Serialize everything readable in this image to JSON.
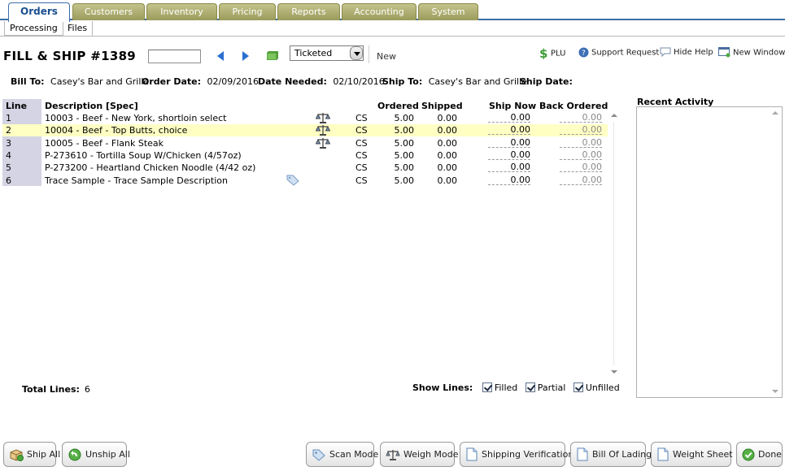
{
  "tabs": [
    {
      "label": "Orders",
      "active": true
    },
    {
      "label": "Customers"
    },
    {
      "label": "Inventory"
    },
    {
      "label": "Pricing"
    },
    {
      "label": "Reports"
    },
    {
      "label": "Accounting"
    },
    {
      "label": "System"
    }
  ],
  "subtabs": [
    {
      "label": "Processing",
      "active": true
    },
    {
      "label": "Files"
    }
  ],
  "header": {
    "title": "FILL & SHIP #1389",
    "order_input_value": "",
    "status_value": "Ticketed",
    "new_label": "New",
    "links": {
      "plu": "PLU",
      "support": "Support Request",
      "hide_help": "Hide Help",
      "new_window": "New Window"
    }
  },
  "info": {
    "bill_to_label": "Bill To:",
    "bill_to": "Casey's Bar and Grille",
    "order_date_label": "Order Date:",
    "order_date": "02/09/2016",
    "date_needed_label": "Date Needed:",
    "date_needed": "02/10/2016",
    "ship_to_label": "Ship To:",
    "ship_to": "Casey's Bar and Grille",
    "ship_date_label": "Ship Date:",
    "ship_date": ""
  },
  "grid": {
    "headers": {
      "line": "Line",
      "description": "Description [Spec]",
      "ordered": "Ordered",
      "shipped": "Shipped",
      "ship_now": "Ship Now",
      "back_ordered": "Back Ordered"
    },
    "rows": [
      {
        "line": "1",
        "description": "10003 - Beef - New York, shortloin select",
        "icon": "scale-icon",
        "unit": "CS",
        "ordered": "5.00",
        "shipped": "0.00",
        "ship_now": "0.00",
        "back_ordered": "0.00",
        "highlight": false
      },
      {
        "line": "2",
        "description": "10004 - Beef - Top Butts, choice",
        "icon": "scale-icon",
        "unit": "CS",
        "ordered": "5.00",
        "shipped": "0.00",
        "ship_now": "0.00",
        "back_ordered": "0.00",
        "highlight": true
      },
      {
        "line": "3",
        "description": "10005 - Beef - Flank Steak",
        "icon": "scale-icon",
        "unit": "CS",
        "ordered": "5.00",
        "shipped": "0.00",
        "ship_now": "0.00",
        "back_ordered": "0.00",
        "highlight": false
      },
      {
        "line": "4",
        "description": "P-273610 - Tortilla Soup W/Chicken (4/57oz)",
        "icon": "",
        "unit": "CS",
        "ordered": "5.00",
        "shipped": "0.00",
        "ship_now": "0.00",
        "back_ordered": "0.00",
        "highlight": false
      },
      {
        "line": "5",
        "description": "P-273200 - Heartland Chicken Noodle (4/42 oz)",
        "icon": "",
        "unit": "CS",
        "ordered": "5.00",
        "shipped": "0.00",
        "ship_now": "0.00",
        "back_ordered": "0.00",
        "highlight": false
      },
      {
        "line": "6",
        "description": "Trace Sample - Trace Sample Description",
        "icon": "tag-icon",
        "unit": "CS",
        "ordered": "5.00",
        "shipped": "0.00",
        "ship_now": "0.00",
        "back_ordered": "0.00",
        "highlight": false
      }
    ]
  },
  "recent_activity": {
    "title": "Recent Activity"
  },
  "footer": {
    "total_lines_label": "Total Lines:",
    "total_lines": "6",
    "show_lines_label": "Show Lines:",
    "filters": [
      {
        "label": "Filled",
        "checked": true
      },
      {
        "label": "Partial",
        "checked": true
      },
      {
        "label": "Unfilled",
        "checked": true
      }
    ]
  },
  "buttons": {
    "ship_all": "Ship All",
    "unship_all": "Unship All",
    "scan_mode": "Scan Mode",
    "weigh_mode": "Weigh Mode",
    "shipping_verification": "Shipping Verification",
    "bill_of_lading": "Bill Of Lading",
    "weight_sheet": "Weight Sheet",
    "done": "Done"
  },
  "colors": {
    "tab_active_text": "#1b4f8f",
    "tab_inactive": "#b0b070",
    "row_highlight": "#ffffc4",
    "line_column": "#d4d4e4"
  }
}
